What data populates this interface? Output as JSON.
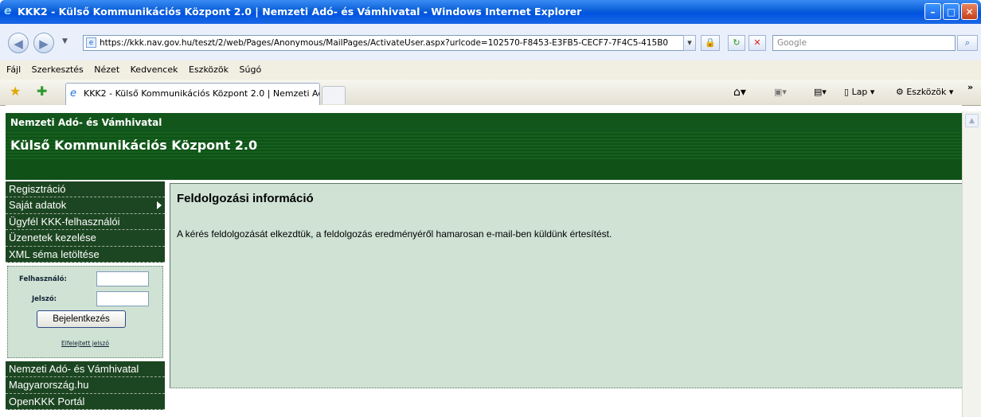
{
  "window": {
    "title": "KKK2 - Külső Kommunikációs Központ 2.0 | Nemzeti Adó- és Vámhivatal - Windows Internet Explorer",
    "buttons": [
      "–",
      "□",
      "✕"
    ]
  },
  "address_bar": {
    "url": "https://kkk.nav.gov.hu/teszt/2/web/Pages/Anonymous/MailPages/ActivateUser.aspx?urlcode=102570-F8453-E3FB5-CECF7-7F4C5-415B0",
    "search_placeholder": "Google"
  },
  "menu": {
    "items": [
      "Fájl",
      "Szerkesztés",
      "Nézet",
      "Kedvencek",
      "Eszközök",
      "Súgó"
    ]
  },
  "command_bar": {
    "tab_title": "KKK2 - Külső Kommunikációs Központ 2.0 | Nemzeti Ad...",
    "lap_label": "Lap",
    "tools_label": "Eszközök"
  },
  "site": {
    "org_name": "Nemzeti Adó- és Vámhivatal",
    "app_title": "Külső Kommunikációs Központ 2.0"
  },
  "sidebar": {
    "top_items": [
      "Regisztráció",
      "Saját adatok",
      "Ügyfél KKK-felhasználói",
      "Üzenetek kezelése",
      "XML séma letöltése"
    ],
    "login": {
      "user_label": "Felhasználó:",
      "password_label": "Jelszó:",
      "submit_label": "Bejelentkezés",
      "forgot_label": "Elfelejtett jelszó"
    },
    "bottom_items": [
      "Nemzeti Adó- és Vámhivatal",
      "Magyarország.hu",
      "OpenKKK Portál"
    ]
  },
  "main": {
    "title": "Feldolgozási információ",
    "message": "A kérés feldolgozását elkezdtük, a feldolgozás eredményéről hamarosan e-mail-ben küldünk értesítést."
  }
}
